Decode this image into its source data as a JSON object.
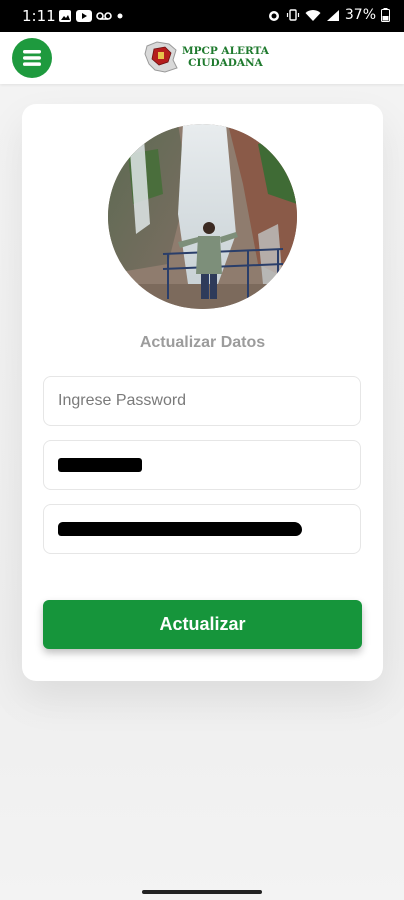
{
  "status_bar": {
    "time": "1:11",
    "battery": "37%"
  },
  "header": {
    "logo_line1": "MPCP ALERTA",
    "logo_line2": "CIUDADANA",
    "menu_icon": "hamburger-menu-icon"
  },
  "form": {
    "title": "Actualizar Datos",
    "password_placeholder": "Ingrese Password",
    "submit_label": "Actualizar"
  },
  "colors": {
    "primary_green": "#16953b",
    "menu_green": "#1e9a3e",
    "logo_green": "#1f7a2e"
  }
}
